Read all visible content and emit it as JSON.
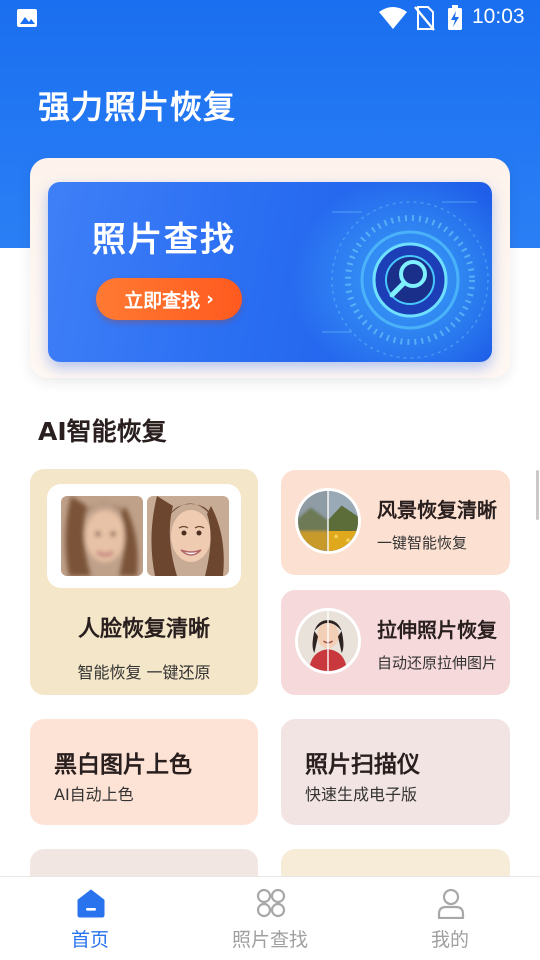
{
  "status_bar": {
    "time": "10:03",
    "icons": [
      "gallery-icon",
      "wifi-icon",
      "no-sim-icon",
      "battery-charging-icon"
    ]
  },
  "app_title": "强力照片恢复",
  "hero": {
    "title": "照片查找",
    "button_label": "立即查找",
    "button_chevron": "›"
  },
  "section_title": "AI智能恢复",
  "features": {
    "face": {
      "title": "人脸恢复清晰",
      "subtitle": "智能恢复 一键还原"
    },
    "landscape": {
      "title": "风景恢复清晰",
      "subtitle": "一键智能恢复"
    },
    "stretch": {
      "title": "拉伸照片恢复",
      "subtitle": "自动还原拉伸图片"
    },
    "colorize": {
      "title": "黑白图片上色",
      "subtitle": "AI自动上色"
    },
    "scanner": {
      "title": "照片扫描仪",
      "subtitle": "快速生成电子版"
    }
  },
  "bottom_nav": [
    {
      "label": "首页",
      "icon": "home-icon",
      "active": true
    },
    {
      "label": "照片查找",
      "icon": "grid-icon",
      "active": false
    },
    {
      "label": "我的",
      "icon": "user-icon",
      "active": false
    }
  ],
  "colors": {
    "primary": "#2a73ef",
    "accent_button": "#ff5a1f",
    "face_card": "#f4e6c8",
    "landscape_card": "#fce1d2",
    "stretch_card": "#f6dadb",
    "colorize_card": "#fde3d5",
    "scanner_card": "#f2e4e3"
  }
}
